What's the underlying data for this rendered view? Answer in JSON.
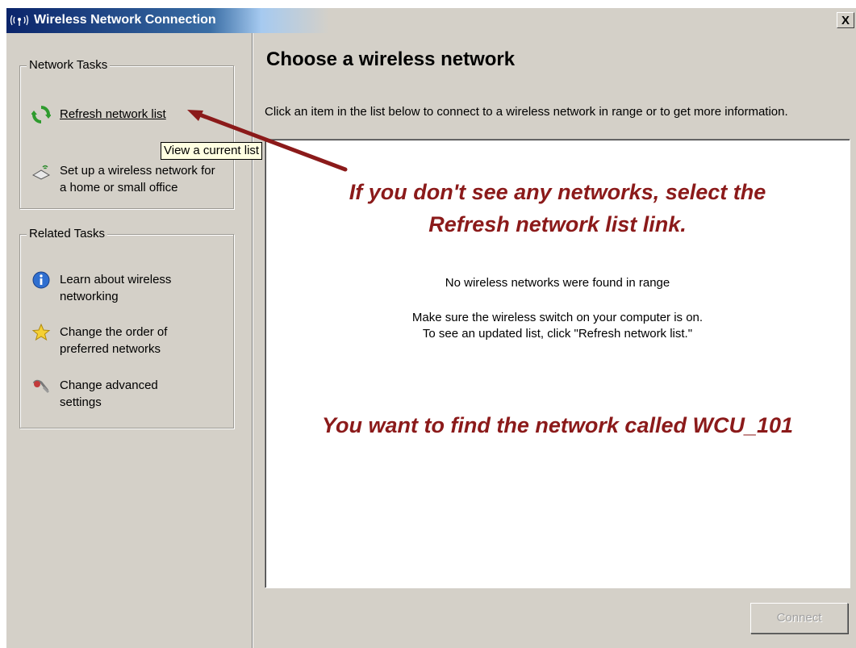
{
  "window": {
    "title": "Wireless Network Connection",
    "close_label": "X"
  },
  "sidebar": {
    "network_tasks": {
      "title": "Network Tasks",
      "items": [
        {
          "icon": "refresh-icon",
          "label": "Refresh network list"
        },
        {
          "icon": "wireless-setup-icon",
          "label": "Set up a wireless network for a home or small office"
        }
      ]
    },
    "related_tasks": {
      "title": "Related Tasks",
      "items": [
        {
          "icon": "info-icon",
          "label": "Learn about wireless networking"
        },
        {
          "icon": "star-icon",
          "label": "Change the order of preferred networks"
        },
        {
          "icon": "settings-icon",
          "label": "Change advanced settings"
        }
      ]
    }
  },
  "tooltip": "View a current list",
  "main": {
    "heading": "Choose a wireless network",
    "instruction": "Click an item in the list below to connect to a wireless network in range or to get more information.",
    "network_list": {
      "empty_title": "No wireless networks were found in range",
      "empty_hint_line1": "Make sure the wireless switch on your computer is on.",
      "empty_hint_line2": "To see an updated list, click \"Refresh network list.\""
    },
    "connect_label": "Connect"
  },
  "annotations": {
    "refresh_hint_line1": "If you don't see any networks, select the",
    "refresh_hint_line2": "Refresh network list link.",
    "target_network": "You want to find the network called WCU_101"
  },
  "colors": {
    "annotation": "#8b1a1a",
    "window_face": "#d4d0c8",
    "title_bar": "#0a246a"
  }
}
